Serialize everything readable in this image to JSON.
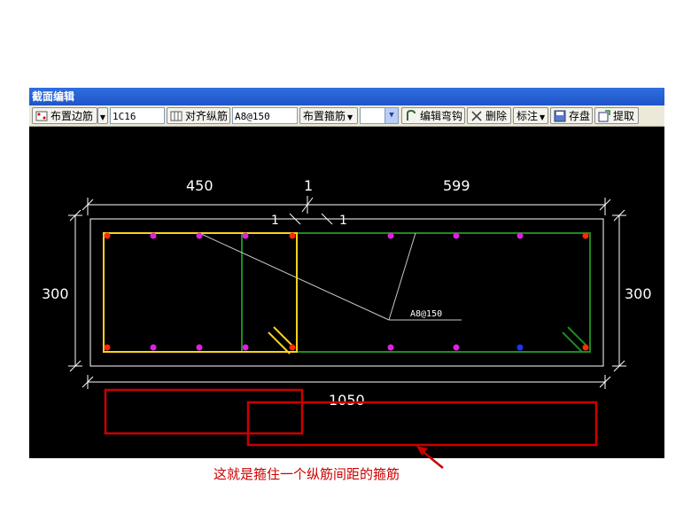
{
  "window": {
    "title": "截面编辑"
  },
  "toolbar": {
    "place_side_rebar": "布置边筋",
    "rebar_value": "1C16",
    "align_long_rebar": "对齐纵筋",
    "stirrup_value": "A8@150",
    "place_stirrup": "布置箍筋",
    "edit_hook": "编辑弯钩",
    "delete": "删除",
    "annotate": "标注",
    "save": "存盘",
    "extract": "提取"
  },
  "drawing": {
    "dim_left": "450",
    "dim_mid": "1",
    "dim_right": "599",
    "dim_small_left": "1",
    "dim_small_right": "1",
    "dim_height_left": "300",
    "dim_height_right": "300",
    "dim_total": "1050",
    "stirrup_label": "A8@150"
  },
  "caption": "这就是箍住一个纵筋间距的箍筋",
  "colors": {
    "title_bar": "#1f54c8",
    "yellow_stirrup": "#ffd21f",
    "green_stirrup": "#1f8a1f",
    "rebar_corner": "#ff2a00",
    "rebar_side": "#e020e0",
    "rebar_blue": "#2030ff",
    "highlight": "#cc0000"
  }
}
